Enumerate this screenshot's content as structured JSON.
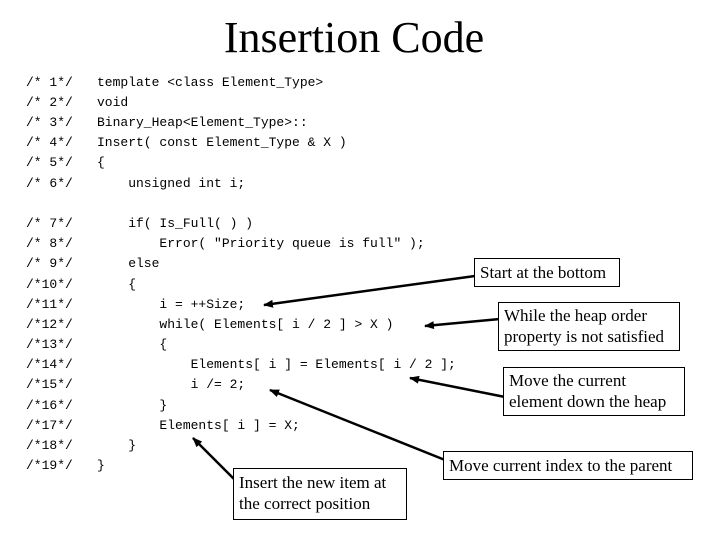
{
  "slide": {
    "title": "Insertion Code"
  },
  "code": {
    "lines": [
      {
        "num": "/* 1*/",
        "text": "template <class Element_Type>"
      },
      {
        "num": "/* 2*/",
        "text": "void"
      },
      {
        "num": "/* 3*/",
        "text": "Binary_Heap<Element_Type>::"
      },
      {
        "num": "/* 4*/",
        "text": "Insert( const Element_Type & X )"
      },
      {
        "num": "/* 5*/",
        "text": "{"
      },
      {
        "num": "/* 6*/",
        "text": "    unsigned int i;"
      },
      {
        "num": "/* 7*/",
        "text": "    if( Is_Full( ) )"
      },
      {
        "num": "/* 8*/",
        "text": "        Error( \"Priority queue is full\" );"
      },
      {
        "num": "/* 9*/",
        "text": "    else"
      },
      {
        "num": "/*10*/",
        "text": "    {"
      },
      {
        "num": "/*11*/",
        "text": "        i = ++Size;"
      },
      {
        "num": "/*12*/",
        "text": "        while( Elements[ i / 2 ] > X )"
      },
      {
        "num": "/*13*/",
        "text": "        {"
      },
      {
        "num": "/*14*/",
        "text": "            Elements[ i ] = Elements[ i / 2 ];"
      },
      {
        "num": "/*15*/",
        "text": "            i /= 2;"
      },
      {
        "num": "/*16*/",
        "text": "        }"
      },
      {
        "num": "/*17*/",
        "text": "        Elements[ i ] = X;"
      },
      {
        "num": "/*18*/",
        "text": "    }"
      },
      {
        "num": "/*19*/",
        "text": "}"
      }
    ]
  },
  "callouts": {
    "start_bottom": "Start at the bottom",
    "heap_order": "While the heap order\nproperty is not satisfied",
    "move_element": "Move the current\nelement down the heap",
    "move_index": "Move current index to the parent",
    "insert_item": "Insert the new item at\nthe correct position"
  }
}
